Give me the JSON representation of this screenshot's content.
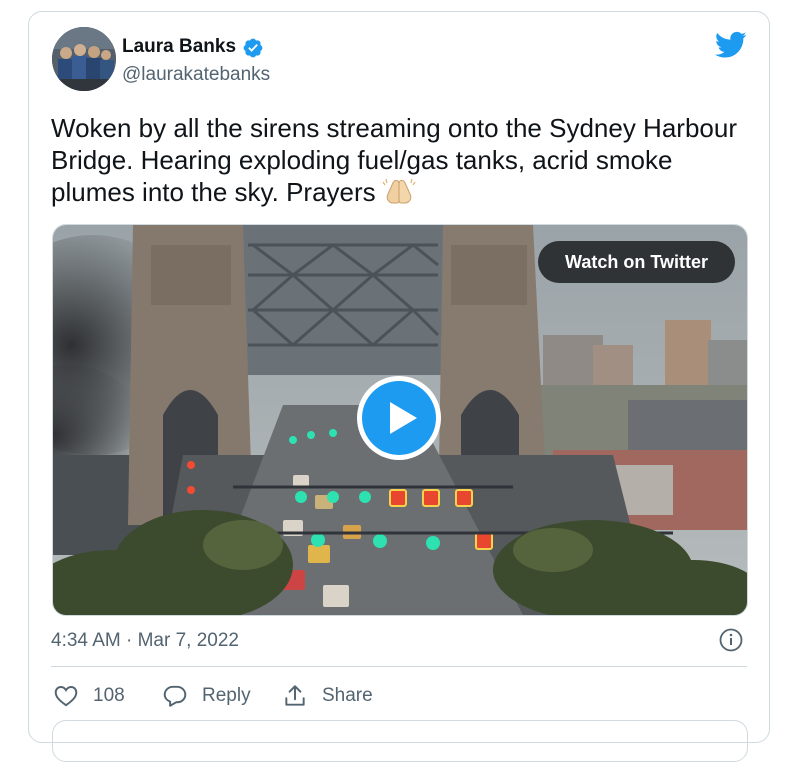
{
  "tweet": {
    "author_name": "Laura Banks",
    "author_handle": "@laurakatebanks",
    "text": "Woken by all the sirens streaming onto the Sydney Harbour Bridge. Hearing exploding fuel/gas tanks, acrid smoke plumes into the sky. Prayers",
    "timestamp": "4:34 AM · Mar 7, 2022"
  },
  "media": {
    "watch_label": "Watch on Twitter"
  },
  "actions": {
    "like_count": "108",
    "reply_label": "Reply",
    "share_label": "Share"
  },
  "icons": {
    "verified": "verified-badge-icon",
    "brand": "twitter-bird-icon",
    "emoji": "praying-hands-emoji",
    "play": "play-icon",
    "info": "info-icon",
    "like": "heart-icon",
    "reply": "reply-bubble-icon",
    "share": "share-upload-icon"
  },
  "colors": {
    "brand_blue": "#1d9bf0",
    "text_primary": "#0f1419",
    "text_secondary": "#536471",
    "border": "#cfd9de",
    "pill_bg": "#2f3336"
  }
}
